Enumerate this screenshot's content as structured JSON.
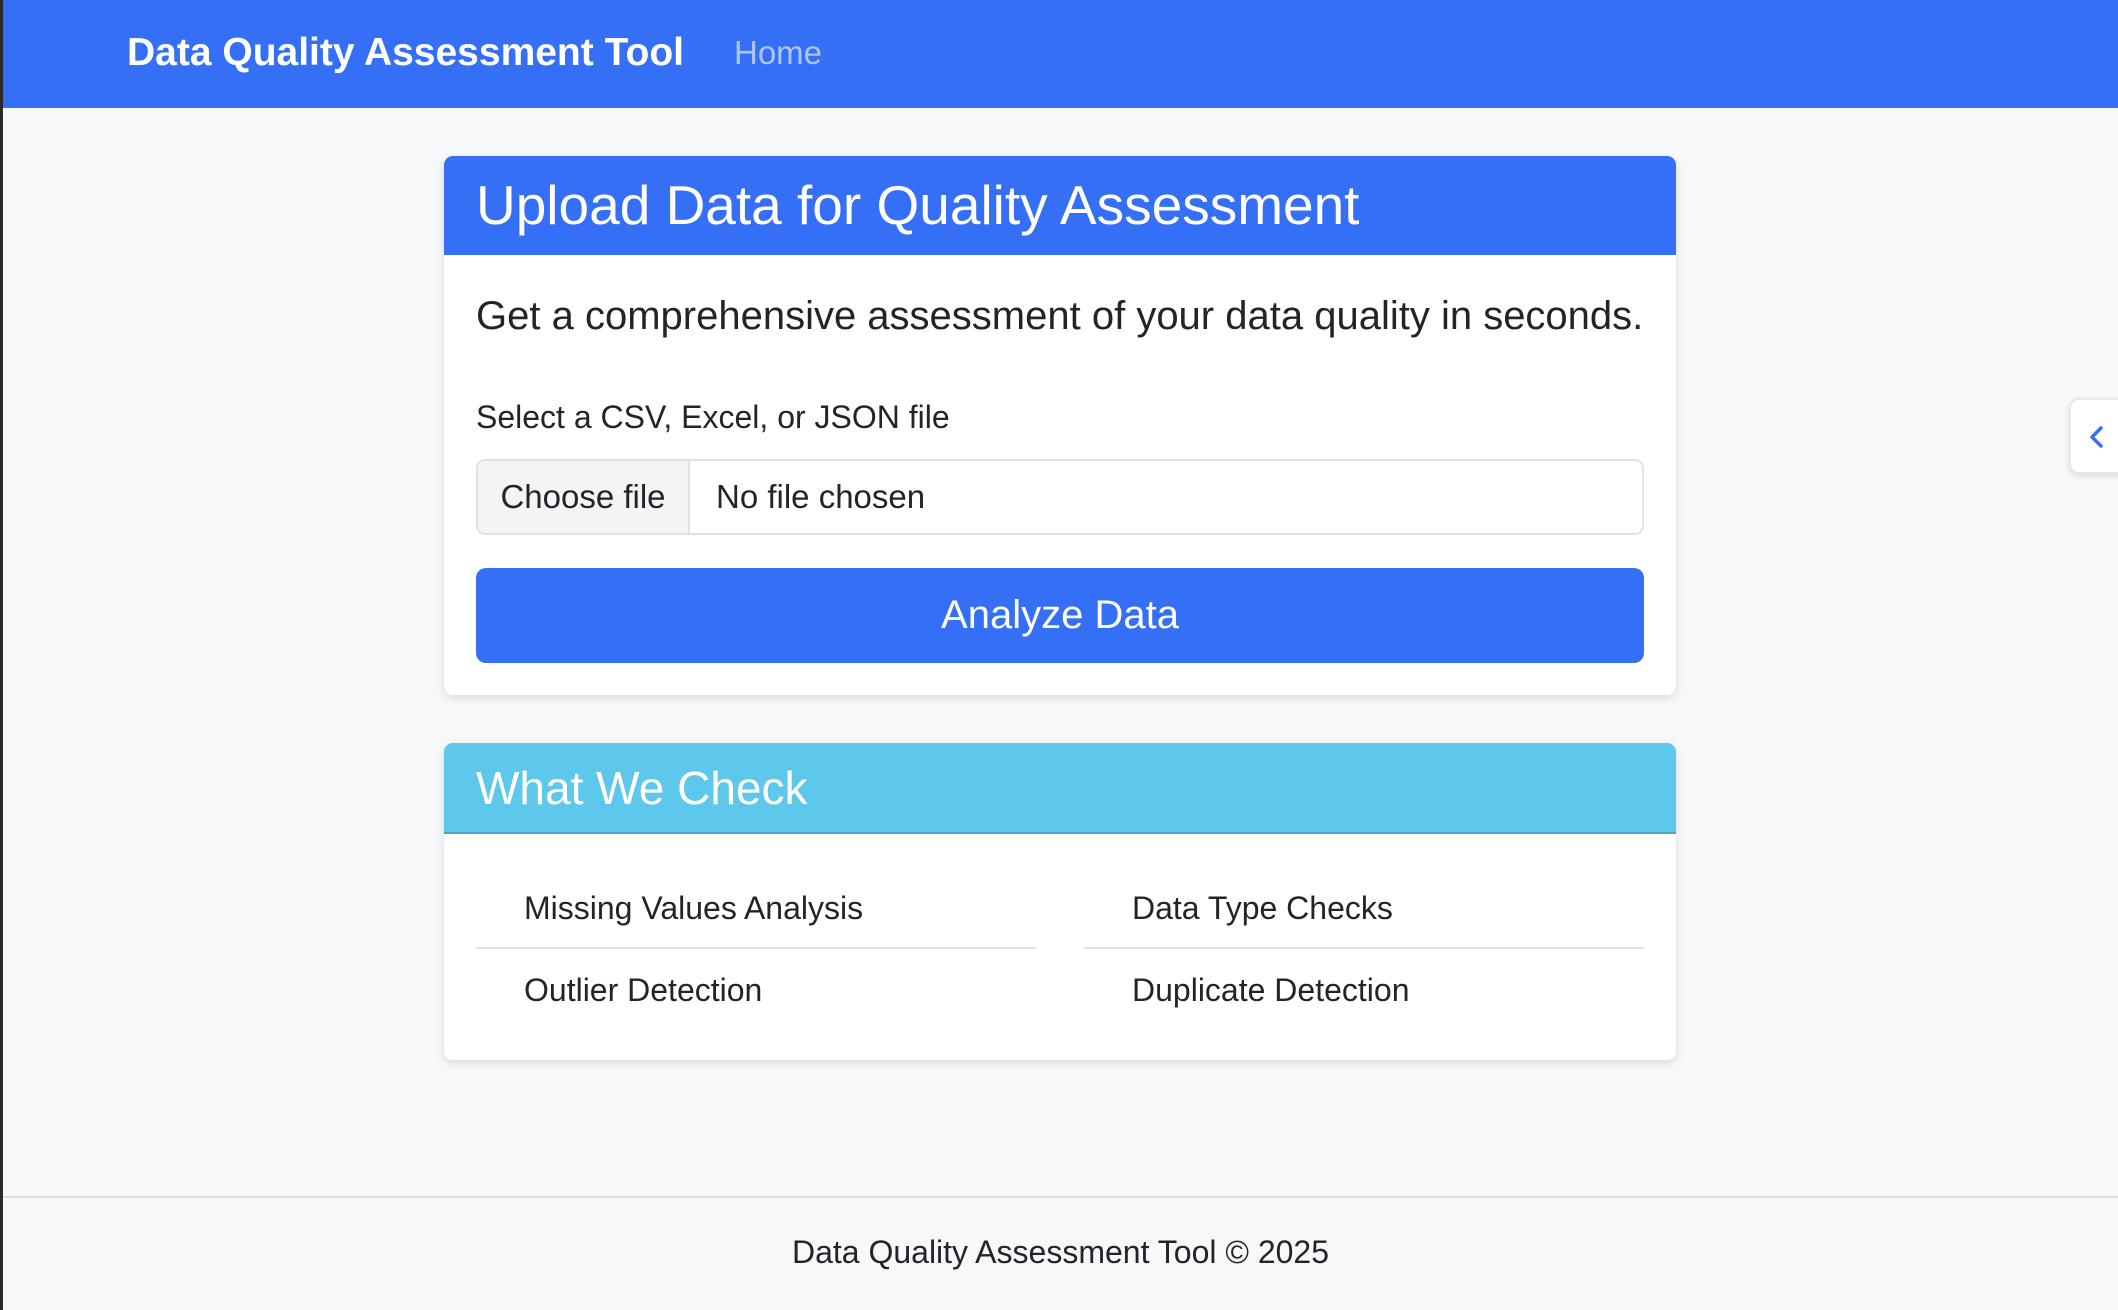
{
  "navbar": {
    "brand": "Data Quality Assessment Tool",
    "links": [
      "Home"
    ]
  },
  "upload_card": {
    "title": "Upload Data for Quality Assessment",
    "lead": "Get a comprehensive assessment of your data quality in seconds.",
    "file_label": "Select a CSV, Excel, or JSON file",
    "file_button": "Choose file",
    "file_status": "No file chosen",
    "submit_label": "Analyze Data"
  },
  "check_card": {
    "title": "What We Check",
    "items": [
      "Missing Values Analysis",
      "Data Type Checks",
      "Outlier Detection",
      "Duplicate Detection"
    ]
  },
  "side_toggle": {
    "icon": "chevron-left-icon"
  },
  "footer": {
    "text": "Data Quality Assessment Tool © 2025"
  },
  "colors": {
    "primary": "#356ff5",
    "info": "#5ec8ec",
    "background": "#f7f8fa"
  }
}
